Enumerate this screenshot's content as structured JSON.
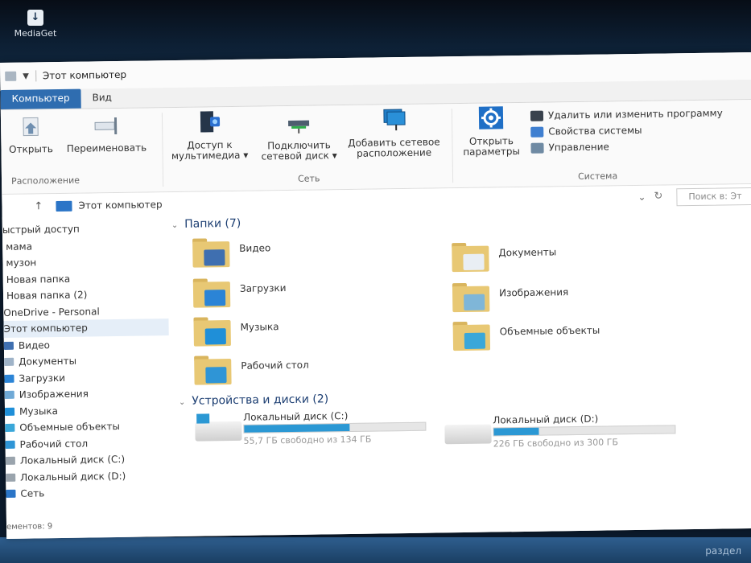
{
  "desktop": {
    "icon_label": "MediaGet",
    "corner_text": "раздел"
  },
  "window": {
    "title": "Этот компьютер",
    "tabs": [
      {
        "label": "Компьютер",
        "active": true
      },
      {
        "label": "Вид",
        "active": false
      }
    ]
  },
  "ribbon": {
    "location": {
      "open": "Открыть",
      "rename": "Переименовать",
      "group_label": "Расположение"
    },
    "network": {
      "media_line1": "Доступ к",
      "media_line2": "мультимедиа",
      "map_line1": "Подключить",
      "map_line2": "сетевой диск",
      "addloc_line1": "Добавить сетевое",
      "addloc_line2": "расположение",
      "group_label": "Сеть"
    },
    "system": {
      "open_line1": "Открыть",
      "open_line2": "параметры",
      "uninstall": "Удалить или изменить программу",
      "properties": "Свойства системы",
      "manage": "Управление",
      "group_label": "Система"
    }
  },
  "address": {
    "path": "Этот компьютер",
    "search_placeholder": "Поиск в: Эт"
  },
  "nav_items": [
    {
      "label": "ыстрый доступ",
      "type": "quick"
    },
    {
      "label": "мама",
      "type": "folder"
    },
    {
      "label": "музон",
      "type": "folder"
    },
    {
      "label": "Новая папка",
      "type": "folder"
    },
    {
      "label": "Новая папка (2)",
      "type": "folder"
    },
    {
      "label": "OneDrive - Personal",
      "type": "cloud"
    },
    {
      "label": "Этот компьютер",
      "type": "pc"
    },
    {
      "label": "Видео",
      "type": "video"
    },
    {
      "label": "Документы",
      "type": "docs"
    },
    {
      "label": "Загрузки",
      "type": "download"
    },
    {
      "label": "Изображения",
      "type": "images"
    },
    {
      "label": "Музыка",
      "type": "music"
    },
    {
      "label": "Объемные объекты",
      "type": "3d"
    },
    {
      "label": "Рабочий стол",
      "type": "desktop"
    },
    {
      "label": "Локальный диск (C:)",
      "type": "drive"
    },
    {
      "label": "Локальный диск (D:)",
      "type": "drive"
    },
    {
      "label": "Сеть",
      "type": "network"
    }
  ],
  "status_text": "ементов: 9",
  "folders": {
    "title": "Папки (7)",
    "items": [
      {
        "name": "Видео",
        "overlay": "#3f6fb0"
      },
      {
        "name": "Документы",
        "overlay": "#e9eef4"
      },
      {
        "name": "Загрузки",
        "overlay": "#2b84d6"
      },
      {
        "name": "Изображения",
        "overlay": "#7fb6d8"
      },
      {
        "name": "Музыка",
        "overlay": "#1f8fd8"
      },
      {
        "name": "Объемные объекты",
        "overlay": "#3aa7d9"
      },
      {
        "name": "Рабочий стол",
        "overlay": "#2f95d6"
      }
    ]
  },
  "drives": {
    "title": "Устройства и диски (2)",
    "items": [
      {
        "name": "Локальный диск (C:)",
        "free": "55,7 ГБ свободно из 134 ГБ",
        "used_fraction": 0.58
      },
      {
        "name": "Локальный диск (D:)",
        "free": "226 ГБ свободно из 300 ГБ",
        "used_fraction": 0.25
      }
    ]
  },
  "colors": {
    "accent": "#2f6db0",
    "drive_bar": "#2b98d4",
    "folder": "#e8c874"
  }
}
